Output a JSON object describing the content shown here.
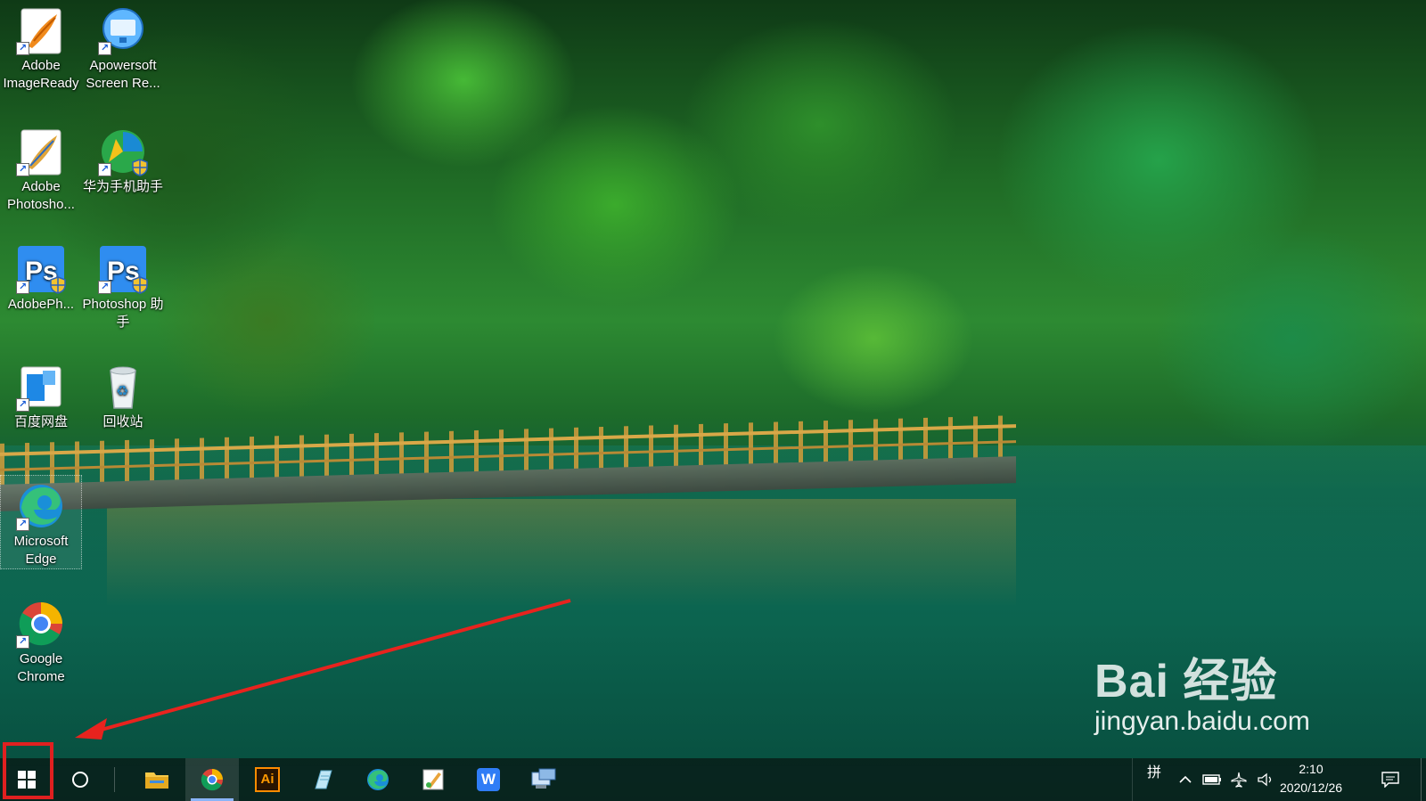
{
  "desktop_icons": [
    {
      "name": "adobe-imageready",
      "label": "Adobe ImageReady",
      "icon": "feather-orange-icon"
    },
    {
      "name": "apowersoft",
      "label": "Apowersoft Screen Re...",
      "icon": "screen-recorder-icon"
    },
    {
      "name": "adobe-photoshop",
      "label": "Adobe Photosho...",
      "icon": "feather-blue-icon"
    },
    {
      "name": "huawei-assistant",
      "label": "华为手机助手",
      "icon": "huawei-icon"
    },
    {
      "name": "adobeph",
      "label": "AdobePh...",
      "icon": "ps-icon"
    },
    {
      "name": "photoshop-helper",
      "label": "Photoshop 助手",
      "icon": "ps-icon"
    },
    {
      "name": "baidu-netdisk",
      "label": "百度网盘",
      "icon": "baidu-netdisk-icon"
    },
    {
      "name": "recycle-bin",
      "label": "回收站",
      "icon": "recycle-bin-icon"
    },
    {
      "name": "microsoft-edge",
      "label": "Microsoft Edge",
      "icon": "edge-icon"
    },
    {
      "name": "google-chrome",
      "label": "Google Chrome",
      "icon": "chrome-icon"
    }
  ],
  "taskbar": {
    "apps": [
      {
        "name": "file-explorer",
        "icon": "folder-icon"
      },
      {
        "name": "chrome",
        "icon": "chrome-icon"
      },
      {
        "name": "illustrator",
        "icon": "illustrator-icon",
        "text": "Ai"
      },
      {
        "name": "notepad",
        "icon": "notepad-icon"
      },
      {
        "name": "edge",
        "icon": "edge-icon"
      },
      {
        "name": "paint",
        "icon": "paint-icon"
      },
      {
        "name": "wps",
        "icon": "wps-icon",
        "text": "W"
      },
      {
        "name": "remote-desktop",
        "icon": "remote-desktop-icon"
      }
    ],
    "ime": "拼",
    "time": "2:10",
    "date": "2020/12/26"
  },
  "watermark": {
    "brand": "Bai 经验",
    "site": "jingyan.baidu.com"
  },
  "colors": {
    "highlight_red": "#e02020",
    "taskbar_bg": "#081814"
  }
}
